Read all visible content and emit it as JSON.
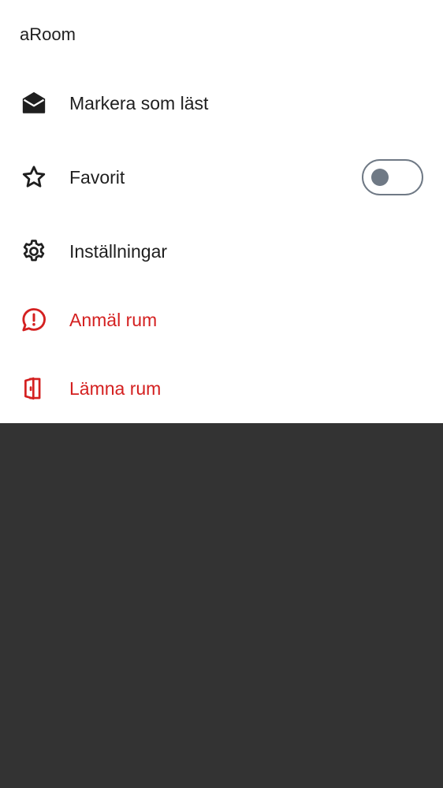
{
  "sheet": {
    "title": "aRoom",
    "items": [
      {
        "label": "Markera som läst",
        "icon": "mail-open-icon"
      },
      {
        "label": "Favorit",
        "icon": "star-icon",
        "toggle_on": false
      },
      {
        "label": "Inställningar",
        "icon": "gear-icon"
      },
      {
        "label": "Anmäl rum",
        "icon": "report-bubble-icon"
      },
      {
        "label": "Lämna rum",
        "icon": "door-exit-icon"
      }
    ]
  },
  "colors": {
    "text": "#1f1f1f",
    "danger": "#d42020",
    "toggle_off": "#6f7985",
    "backdrop": "#333333"
  }
}
